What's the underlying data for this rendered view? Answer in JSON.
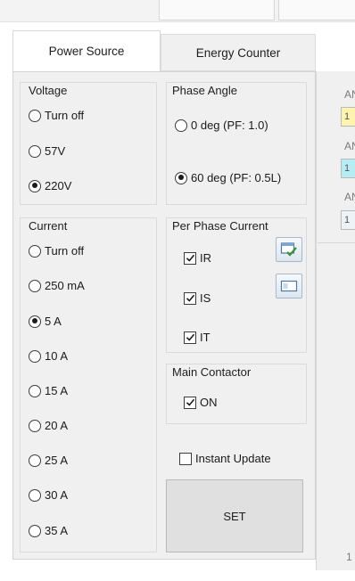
{
  "tabs": [
    {
      "label": "Power Source",
      "active": true
    },
    {
      "label": "Energy Counter",
      "active": false
    }
  ],
  "voltage": {
    "title": "Voltage",
    "options": [
      "Turn off",
      "57V",
      "220V"
    ],
    "selected": "220V"
  },
  "phase_angle": {
    "title": "Phase Angle",
    "options": [
      "0 deg (PF: 1.0)",
      "60 deg (PF: 0.5L)"
    ],
    "selected": "60 deg (PF: 0.5L)"
  },
  "current": {
    "title": "Current",
    "options": [
      "Turn off",
      "250 mA",
      "5 A",
      "10 A",
      "15 A",
      "20 A",
      "25 A",
      "30 A",
      "35 A"
    ],
    "selected": "5 A"
  },
  "per_phase_current": {
    "title": "Per Phase Current",
    "items": [
      {
        "label": "IR",
        "checked": true
      },
      {
        "label": "IS",
        "checked": true
      },
      {
        "label": "IT",
        "checked": true
      }
    ],
    "icons": [
      "select-all-icon",
      "deselect-all-icon"
    ]
  },
  "main_contactor": {
    "title": "Main Contactor",
    "label": "ON",
    "checked": true
  },
  "instant_update": {
    "label": "Instant Update",
    "checked": false
  },
  "set_button": {
    "label": "SET"
  },
  "side_panel": {
    "labels": [
      "AN",
      "AN",
      "AN"
    ],
    "values": [
      "1",
      "1",
      "1"
    ],
    "bottom_text": "1",
    "value_colors": [
      "#fff3b0",
      "#b8ecf5",
      "#eef3f8"
    ]
  },
  "colors": {
    "panel_bg": "#f0f0f0",
    "border": "#d3d3d3",
    "accent_check": "#3a8f3a"
  }
}
